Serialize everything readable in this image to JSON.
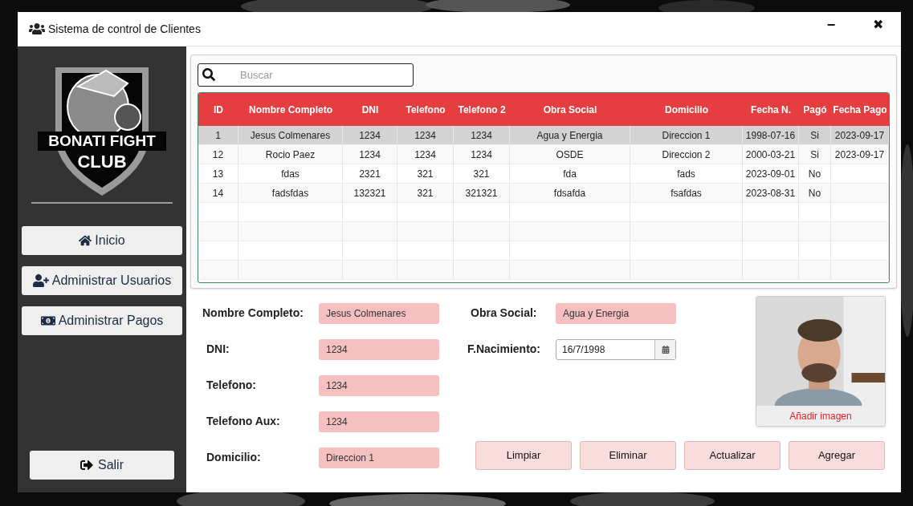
{
  "window": {
    "title": "Sistema de control de Clientes",
    "minimize": "−",
    "close": "✖"
  },
  "sidebar": {
    "logo": {
      "line1": "BONATI FIGHT",
      "line2": "CLUB"
    },
    "items": [
      {
        "label": "Inicio"
      },
      {
        "label": "Administrar Usuarios"
      },
      {
        "label": "Administrar Pagos"
      }
    ],
    "logout": {
      "label": "Salir"
    }
  },
  "search": {
    "placeholder": "Buscar"
  },
  "table": {
    "columns": [
      "ID",
      "Nombre Completo",
      "DNI",
      "Telefono",
      "Telefono 2",
      "Obra Social",
      "Domicilio",
      "Fecha N.",
      "Pagó",
      "Fecha Pago"
    ],
    "rows": [
      {
        "selected": true,
        "cells": [
          "1",
          "Jesus Colmenares",
          "1234",
          "1234",
          "1234",
          "Agua y Energia",
          "Direccion 1",
          "1998-07-16",
          "Si",
          "2023-09-17"
        ]
      },
      {
        "selected": false,
        "cells": [
          "12",
          "Rocio Paez",
          "1234",
          "1234",
          "1234",
          "OSDE",
          "Direccion 2",
          "2000-03-21",
          "Si",
          "2023-09-17"
        ]
      },
      {
        "selected": false,
        "cells": [
          "13",
          "fdas",
          "2321",
          "321",
          "321",
          "fda",
          "fads",
          "2023-09-01",
          "No",
          ""
        ]
      },
      {
        "selected": false,
        "cells": [
          "14",
          "fadsfdas",
          "132321",
          "321",
          "321321",
          "fdsafda",
          "fsafdas",
          "2023-08-31",
          "No",
          ""
        ]
      }
    ]
  },
  "form": {
    "left": [
      {
        "label": "Nombre Completo:",
        "value": "Jesus Colmenares"
      },
      {
        "label": "DNI:",
        "value": "1234"
      },
      {
        "label": "Telefono:",
        "value": "1234"
      },
      {
        "label": "Telefono Aux:",
        "value": "1234"
      },
      {
        "label": "Domicilio:",
        "value": "Direccion 1"
      }
    ],
    "obra_social": {
      "label": "Obra Social:",
      "value": "Agua y Energia"
    },
    "nacimiento": {
      "label": "F.Nacimiento:",
      "value": "16/7/1998"
    },
    "photo": {
      "kind": "picture",
      "button": "Añadir imagen"
    },
    "buttons": [
      "Limpiar",
      "Eliminar",
      "Actualizar",
      "Agregar"
    ]
  }
}
